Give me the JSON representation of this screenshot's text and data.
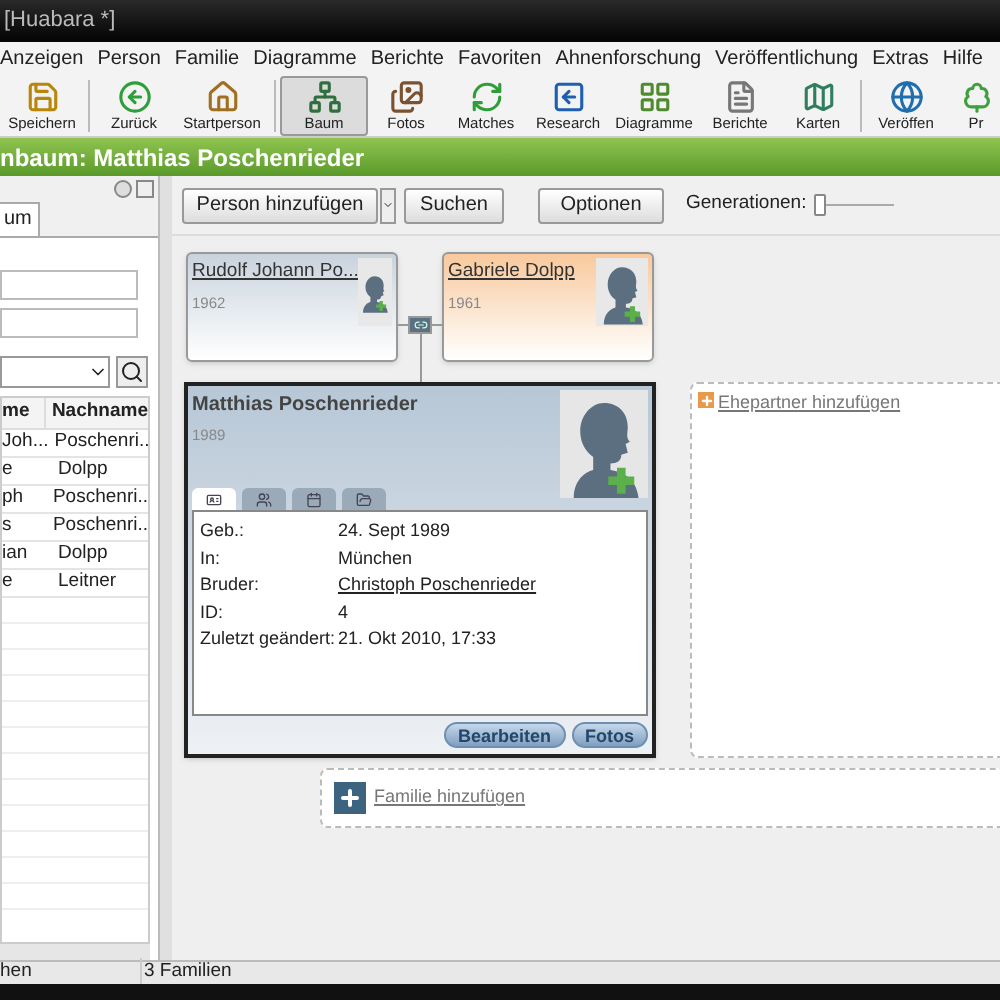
{
  "window": {
    "title": "[Huabara *]"
  },
  "menu": [
    "Anzeigen",
    "Person",
    "Familie",
    "Diagramme",
    "Berichte",
    "Favoriten",
    "Ahnenforschung",
    "Veröffentlichung",
    "Extras",
    "Hilfe"
  ],
  "toolbar": [
    {
      "label": "Speichern",
      "selected": false
    },
    {
      "label": "Zurück",
      "selected": false
    },
    {
      "label": "Startperson",
      "selected": false
    },
    {
      "label": "Baum",
      "selected": true
    },
    {
      "label": "Fotos",
      "selected": false
    },
    {
      "label": "Matches",
      "selected": false
    },
    {
      "label": "Research",
      "selected": false
    },
    {
      "label": "Diagramme",
      "selected": false
    },
    {
      "label": "Berichte",
      "selected": false
    },
    {
      "label": "Karten",
      "selected": false
    },
    {
      "label": "Veröffen",
      "selected": false
    },
    {
      "label": "Pr",
      "selected": false
    }
  ],
  "header": {
    "title": "nbaum: Matthias Poschenrieder"
  },
  "left_panel": {
    "tab": "um",
    "table": {
      "columns": [
        "me",
        "Nachname"
      ],
      "rows": [
        {
          "column_1": "Joh...",
          "nachname": "Poschenri.."
        },
        {
          "column_1": "e",
          "nachname": "Dolpp"
        },
        {
          "column_1": "ph",
          "nachname": "Poschenri.."
        },
        {
          "column_1": "s",
          "nachname": "Poschenri.."
        },
        {
          "column_1": "ian",
          "nachname": "Dolpp"
        },
        {
          "column_1": "e",
          "nachname": "Leitner"
        }
      ]
    }
  },
  "actions": {
    "add_person": "Person hinzufügen",
    "search": "Suchen",
    "options": "Optionen",
    "generations_label": "Generationen:",
    "generations": {
      "level": 0
    }
  },
  "parents": [
    {
      "name": "Rudolf Johann Po...",
      "year": "1962",
      "color": "#c9d3dd"
    },
    {
      "name": "Gabriele Dolpp",
      "year": "1961",
      "color": "#f8c99c"
    }
  ],
  "person": {
    "name": "Matthias Poschenrieder",
    "year": "1989",
    "tabs": [
      {
        "selected": true
      },
      {
        "selected": false
      },
      {
        "selected": false
      },
      {
        "selected": false
      }
    ],
    "details": [
      {
        "label": "Geb.:",
        "value": "24. Sept 1989",
        "kind": "text"
      },
      {
        "label": "In:",
        "value": "München",
        "kind": "text"
      },
      {
        "label": "Bruder:",
        "value": "Christoph Poschenrieder",
        "kind": "link"
      },
      {
        "label": "ID:",
        "value": "4",
        "kind": "text"
      },
      {
        "label": "Zuletzt geändert:",
        "value": "21. Okt 2010, 17:33",
        "kind": "text"
      }
    ],
    "buttons": [
      "Bearbeiten",
      "Fotos"
    ]
  },
  "add_spouse": "Ehepartner hinzufügen",
  "add_family": "Familie hinzufügen",
  "status_bar": [
    "hen",
    "3 Familien"
  ]
}
